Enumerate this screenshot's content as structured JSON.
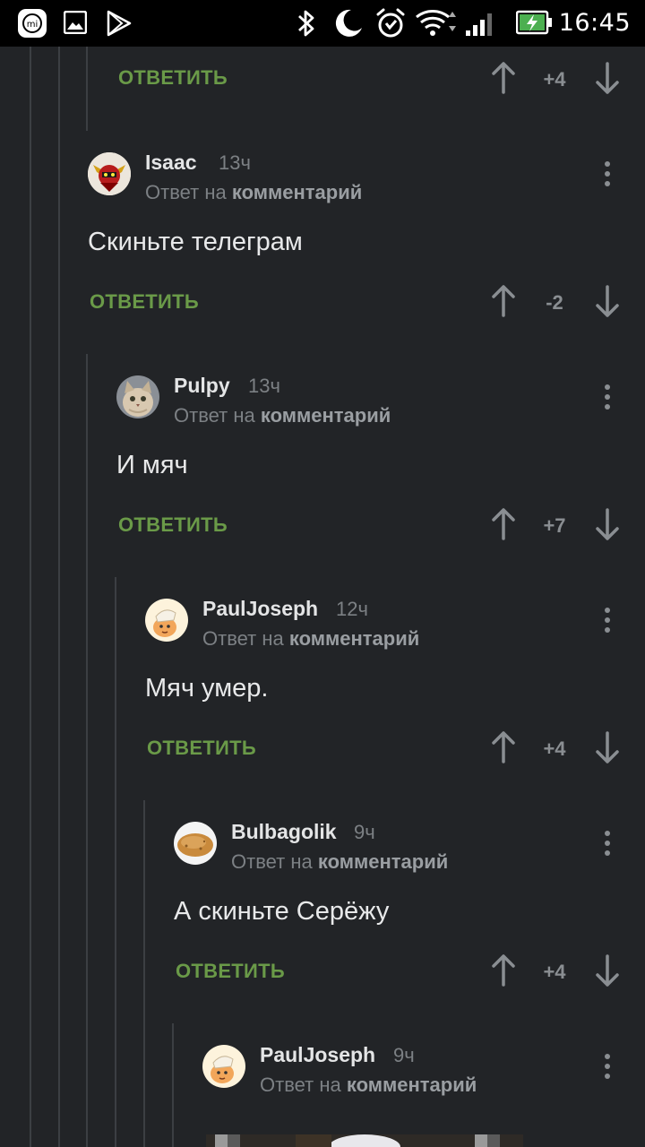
{
  "status_bar": {
    "time": "16:45",
    "left_icons": [
      "mi-icon",
      "gallery-icon",
      "play-store-icon"
    ],
    "right_icons": [
      "bluetooth-icon",
      "moon-icon",
      "alarm-icon",
      "wifi-icon",
      "signal-icon",
      "battery-charging-icon"
    ]
  },
  "labels": {
    "reply_button": "ОТВЕТИТЬ",
    "reply_prefix": "Ответ на",
    "reply_target": "комментарий"
  },
  "colors": {
    "background": "#222427",
    "reply_accent": "#6a9a48",
    "muted_text": "#7c8084"
  },
  "top_partial": {
    "score": "+4"
  },
  "comments": [
    {
      "author": "Isaac",
      "time": "13ч",
      "text": "Скиньте телеграм",
      "score": "-2",
      "avatar": "robot-avatar"
    },
    {
      "author": "Pulpy",
      "time": "13ч",
      "text": "И мяч",
      "score": "+7",
      "avatar": "cat-avatar"
    },
    {
      "author": "PaulJoseph",
      "time": "12ч",
      "text": "Мяч умер.",
      "score": "+4",
      "avatar": "cartoon-face-avatar"
    },
    {
      "author": "Bulbagolik",
      "time": "9ч",
      "text": "А скиньте Серёжу",
      "score": "+4",
      "avatar": "potato-avatar"
    },
    {
      "author": "PaulJoseph",
      "time": "9ч",
      "text": "",
      "score": "",
      "avatar": "cartoon-face-avatar"
    }
  ]
}
